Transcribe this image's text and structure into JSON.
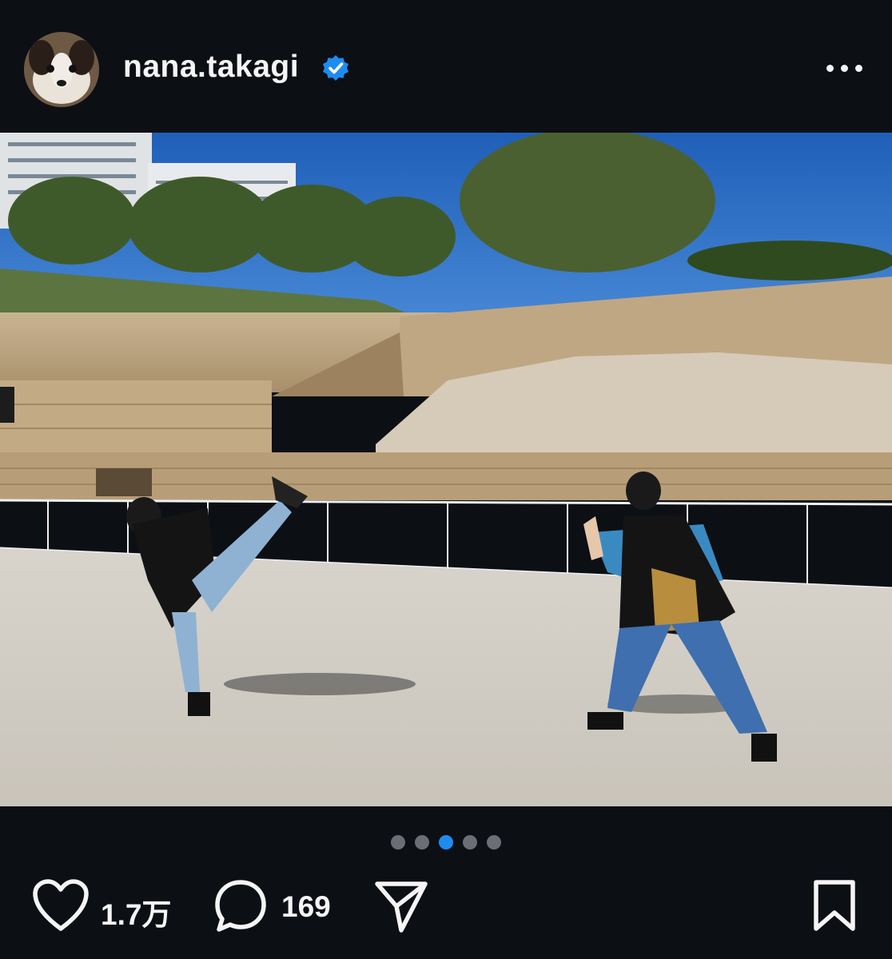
{
  "post": {
    "username": "nana.takagi",
    "verified": true,
    "avatar_icon": "dog-avatar",
    "more_icon": "more-horizontal-icon"
  },
  "carousel": {
    "total": 5,
    "active_index": 3
  },
  "actions": {
    "likes": "1.7万",
    "comments": "169"
  },
  "colors": {
    "background": "#0c0f14",
    "text": "#f5f5f5",
    "verified_blue": "#1d8cf0",
    "dot_inactive": "#6b6e74",
    "dot_active": "#1d8cf0"
  }
}
